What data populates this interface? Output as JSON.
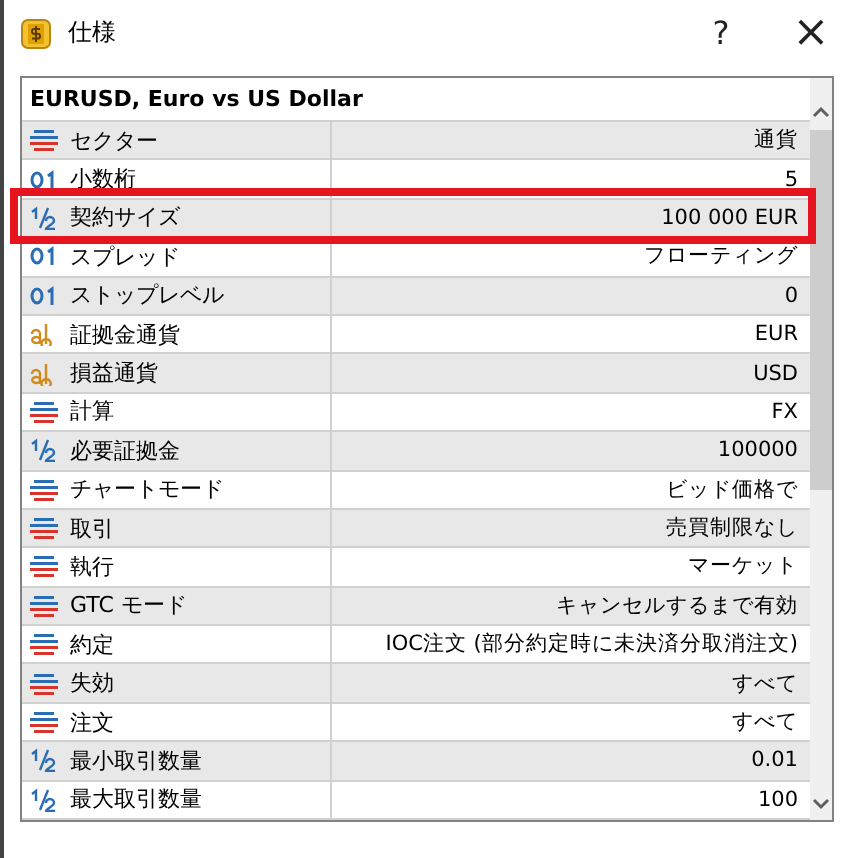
{
  "window": {
    "title": "仕様",
    "help": "?",
    "close": "×"
  },
  "table": {
    "title": "EURUSD, Euro vs US Dollar",
    "rows": [
      {
        "kind": "enum",
        "label": "セクター",
        "value": "通貨",
        "highlighted": false
      },
      {
        "kind": "int",
        "label": "小数桁",
        "value": "5",
        "highlighted": false
      },
      {
        "kind": "fraction",
        "label": "契約サイズ",
        "value": "100 000 EUR",
        "highlighted": true
      },
      {
        "kind": "int",
        "label": "スプレッド",
        "value": "フローティング",
        "highlighted": false
      },
      {
        "kind": "int",
        "label": "ストップレベル",
        "value": "0",
        "highlighted": false
      },
      {
        "kind": "text",
        "label": "証拠金通貨",
        "value": "EUR",
        "highlighted": false
      },
      {
        "kind": "text",
        "label": "損益通貨",
        "value": "USD",
        "highlighted": false
      },
      {
        "kind": "enum",
        "label": "計算",
        "value": "FX",
        "highlighted": false
      },
      {
        "kind": "fraction",
        "label": "必要証拠金",
        "value": "100000",
        "highlighted": false
      },
      {
        "kind": "enum",
        "label": "チャートモード",
        "value": "ビッド価格で",
        "highlighted": false
      },
      {
        "kind": "enum",
        "label": "取引",
        "value": "売買制限なし",
        "highlighted": false
      },
      {
        "kind": "enum",
        "label": "執行",
        "value": "マーケット",
        "highlighted": false
      },
      {
        "kind": "enum",
        "label": "GTC モード",
        "value": "キャンセルするまで有効",
        "highlighted": false
      },
      {
        "kind": "enum",
        "label": "約定",
        "value": "IOC注文 (部分約定時に未決済分取消注文)",
        "highlighted": false
      },
      {
        "kind": "enum",
        "label": "失効",
        "value": "すべて",
        "highlighted": false
      },
      {
        "kind": "enum",
        "label": "注文",
        "value": "すべて",
        "highlighted": false
      },
      {
        "kind": "fraction",
        "label": "最小取引数量",
        "value": "0.01",
        "highlighted": false
      },
      {
        "kind": "fraction",
        "label": "最大取引数量",
        "value": "100",
        "highlighted": false
      }
    ]
  }
}
